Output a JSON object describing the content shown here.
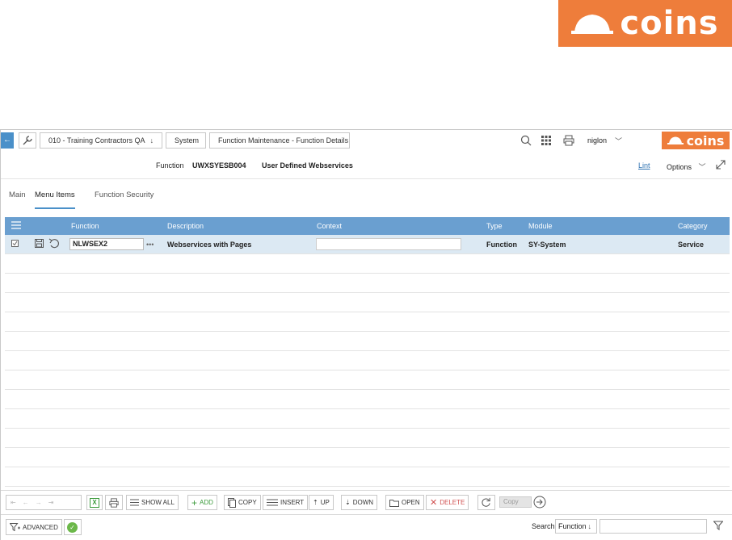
{
  "brand": {
    "name": "coins",
    "color": "#ee7d3b"
  },
  "breadcrumb": {
    "company": "010 - Training Contractors QA",
    "system": "System",
    "page": "Function Maintenance - Function Details"
  },
  "user": {
    "name": "niglon"
  },
  "header": {
    "function_label": "Function",
    "function_code": "UWXSYESB004",
    "function_desc": "User Defined Webservices",
    "lint_label": "Lint",
    "options_label": "Options"
  },
  "tabs": [
    {
      "label": "Main",
      "active": false
    },
    {
      "label": "Menu Items",
      "active": true
    },
    {
      "label": "Function Security",
      "active": false
    }
  ],
  "grid": {
    "columns": [
      "Function",
      "Description",
      "Context",
      "Type",
      "Module",
      "Category"
    ],
    "rows": [
      {
        "function": "NLWSEX2",
        "more": "•••",
        "description": "Webservices with Pages",
        "context": "",
        "type": "Function",
        "module": "SY-System",
        "category": "Service"
      }
    ]
  },
  "toolbar": {
    "show_all": "SHOW ALL",
    "add": "ADD",
    "copy": "COPY",
    "insert": "INSERT",
    "up": "UP",
    "down": "DOWN",
    "open": "OPEN",
    "delete": "DELETE",
    "copy_field_placeholder": "Copy"
  },
  "footer": {
    "advanced": "ADVANCED",
    "search_label": "Search",
    "search_field": "Function",
    "search_value": ""
  },
  "colors": {
    "accent": "#4a90c9",
    "grid_header": "#6a9fd0",
    "selected_row": "#dce9f3"
  }
}
